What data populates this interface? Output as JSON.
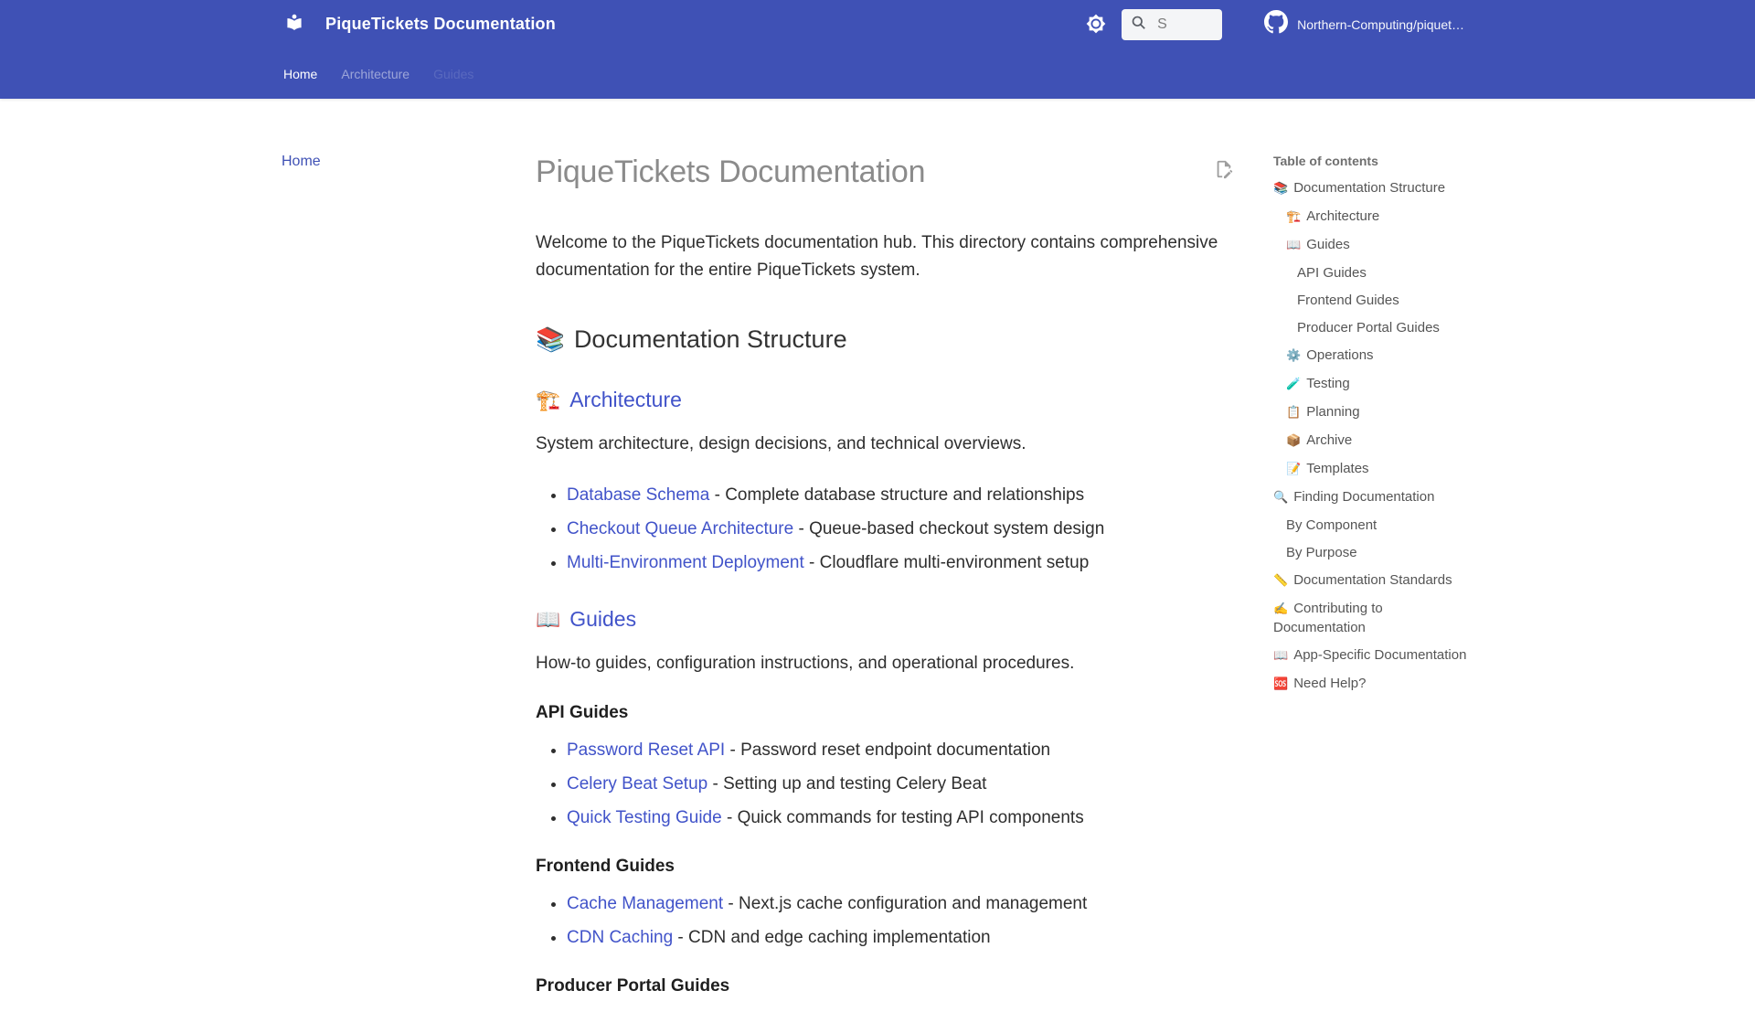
{
  "theme": {
    "primary": "#3f51b5",
    "link": "#4153c9"
  },
  "header": {
    "title": "PiqueTickets Documentation",
    "search": {
      "value": "S"
    },
    "repo_label": "Northern-Computing/piquet…",
    "tabs": [
      {
        "label": "Home"
      },
      {
        "label": "Architecture"
      },
      {
        "label": "Guides"
      }
    ]
  },
  "sidebar": {
    "items": [
      {
        "label": "Home"
      }
    ]
  },
  "content": {
    "page_title": "PiqueTickets Documentation",
    "intro": "Welcome to the PiqueTickets documentation hub. This directory contains comprehensive documentation for the entire PiqueTickets system.",
    "structure": {
      "icon": "📚",
      "title": "Documentation Structure",
      "architecture": {
        "icon": "🏗️",
        "title": "Architecture",
        "description": "System architecture, design decisions, and technical overviews.",
        "items": [
          {
            "link": "Database Schema",
            "desc": " - Complete database structure and relationships"
          },
          {
            "link": "Checkout Queue Architecture",
            "desc": " - Queue-based checkout system design"
          },
          {
            "link": "Multi-Environment Deployment",
            "desc": " - Cloudflare multi-environment setup"
          }
        ]
      },
      "guides": {
        "icon": "📖",
        "title": "Guides",
        "description": "How-to guides, configuration instructions, and operational procedures.",
        "api": {
          "title": "API Guides",
          "items": [
            {
              "link": "Password Reset API",
              "desc": " - Password reset endpoint documentation"
            },
            {
              "link": "Celery Beat Setup",
              "desc": " - Setting up and testing Celery Beat"
            },
            {
              "link": "Quick Testing Guide",
              "desc": " - Quick commands for testing API components"
            }
          ]
        },
        "frontend": {
          "title": "Frontend Guides",
          "items": [
            {
              "link": "Cache Management",
              "desc": " - Next.js cache configuration and management"
            },
            {
              "link": "CDN Caching",
              "desc": " - CDN and edge caching implementation"
            }
          ]
        },
        "producer": {
          "title": "Producer Portal Guides"
        }
      }
    }
  },
  "toc": {
    "title": "Table of contents",
    "items": [
      {
        "icon": "📚",
        "label": "Documentation Structure",
        "level": 1
      },
      {
        "icon": "🏗️",
        "label": "Architecture",
        "level": 2
      },
      {
        "icon": "📖",
        "label": "Guides",
        "level": 2
      },
      {
        "icon": "",
        "label": "API Guides",
        "level": 3
      },
      {
        "icon": "",
        "label": "Frontend Guides",
        "level": 3
      },
      {
        "icon": "",
        "label": "Producer Portal Guides",
        "level": 3
      },
      {
        "icon": "⚙️",
        "label": "Operations",
        "level": 2
      },
      {
        "icon": "🧪",
        "label": "Testing",
        "level": 2
      },
      {
        "icon": "📋",
        "label": "Planning",
        "level": 2
      },
      {
        "icon": "📦",
        "label": "Archive",
        "level": 2
      },
      {
        "icon": "📝",
        "label": "Templates",
        "level": 2
      },
      {
        "icon": "🔍",
        "label": "Finding Documentation",
        "level": 1
      },
      {
        "icon": "",
        "label": "By Component",
        "level": 2
      },
      {
        "icon": "",
        "label": "By Purpose",
        "level": 2
      },
      {
        "icon": "📏",
        "label": "Documentation Standards",
        "level": 1
      },
      {
        "icon": "✍️",
        "label": "Contributing to Documentation",
        "level": 1
      },
      {
        "icon": "📖",
        "label": "App-Specific Documentation",
        "level": 1
      },
      {
        "icon": "🆘",
        "label": "Need Help?",
        "level": 1
      }
    ]
  }
}
